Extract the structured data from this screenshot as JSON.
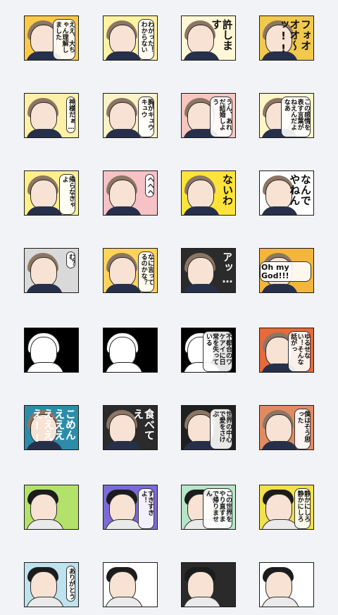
{
  "stickers": [
    {
      "bg": "#fbc94a",
      "caption": "ええ、大ちゃん理解しました",
      "style": "bubble",
      "kind": "woman"
    },
    {
      "bg": "#fff3a3",
      "caption": "わかった！わからない",
      "style": "bubble",
      "kind": "woman"
    },
    {
      "bg": "#fff7d6",
      "caption": "許します",
      "style": "big",
      "kind": "woman"
    },
    {
      "bg": "#f2c94c",
      "caption": "フォオオオ〜ッ!!",
      "style": "big",
      "kind": "woman"
    },
    {
      "bg": "#fff0a8",
      "caption": "神様だぁ…",
      "style": "bubble",
      "kind": "woman"
    },
    {
      "bg": "#fbf3c6",
      "caption": "胸がキュウキュウ",
      "style": "bubble",
      "kind": "woman"
    },
    {
      "bg": "#f8c6c0",
      "caption": "うん、あれだ結婚しよう",
      "style": "bubble",
      "kind": "woman"
    },
    {
      "bg": "#fff6c8",
      "caption": "この感情を表す言葉がねえんだよなあ",
      "style": "bubble",
      "kind": "woman"
    },
    {
      "bg": "#fff08a",
      "caption": "帰らなきゃよ",
      "style": "bubble",
      "kind": "woman"
    },
    {
      "bg": "#f6c2c6",
      "caption": "へへへ",
      "style": "bubble",
      "kind": "woman"
    },
    {
      "bg": "#ffe33a",
      "caption": "ないわ",
      "style": "big",
      "kind": "woman"
    },
    {
      "bg": "#ffffff",
      "caption": "なんでやねん",
      "style": "big",
      "kind": "woman"
    },
    {
      "bg": "#d9d9d9",
      "caption": "む？",
      "style": "bubble",
      "kind": "woman"
    },
    {
      "bg": "#ffd35c",
      "caption": "なに言ってるのかな？",
      "style": "bubble",
      "kind": "woman"
    },
    {
      "bg": "#2b2b2b",
      "caption": "アッ…",
      "style": "big",
      "kind": "woman"
    },
    {
      "bg": "#f4b53c",
      "caption": "Oh my God!!!",
      "style": "horiz",
      "kind": "woman"
    },
    {
      "bg": "#000000",
      "caption": "",
      "style": "none",
      "kind": "dark"
    },
    {
      "bg": "#000000",
      "caption": "",
      "style": "none",
      "kind": "dark"
    },
    {
      "bg": "#000000",
      "caption": "不都合のワケアイに日常を失っている",
      "style": "bubble",
      "kind": "dark"
    },
    {
      "bg": "#e66a3a",
      "caption": "ゆるせない！そんな話がっ",
      "style": "bubble",
      "kind": "woman"
    },
    {
      "bg": "#2d8ca8",
      "caption": "ごめんえええええええ!!",
      "style": "big",
      "kind": "woman"
    },
    {
      "bg": "#2b2b2b",
      "caption": "食べてえ",
      "style": "big",
      "kind": "woman"
    },
    {
      "bg": "#1f1f1f",
      "caption": "世界の中心で愛をさけぶ",
      "style": "bubble",
      "kind": "woman"
    },
    {
      "bg": "#e28b63",
      "caption": "僕はそう思った",
      "style": "bubble",
      "kind": "woman"
    },
    {
      "bg": "#b3e26a",
      "caption": "",
      "style": "none",
      "kind": "man"
    },
    {
      "bg": "#7a6bd6",
      "caption": "すきすきよ！",
      "style": "bubble",
      "kind": "man"
    },
    {
      "bg": "#b7e6c6",
      "caption": "この世界をやり直すまで帰りません",
      "style": "bubble",
      "kind": "man"
    },
    {
      "bg": "#f2e14b",
      "caption": "静かにしろ静かにしろ",
      "style": "bubble",
      "kind": "man"
    },
    {
      "bg": "#bfe3ee",
      "caption": "ありがとう",
      "style": "bubble",
      "kind": "man"
    },
    {
      "bg": "#ffffff",
      "caption": "",
      "style": "none",
      "kind": "man"
    },
    {
      "bg": "#2a2a2a",
      "caption": "",
      "style": "none",
      "kind": "man"
    },
    {
      "bg": "#ffffff",
      "caption": "",
      "style": "none",
      "kind": "man"
    }
  ]
}
